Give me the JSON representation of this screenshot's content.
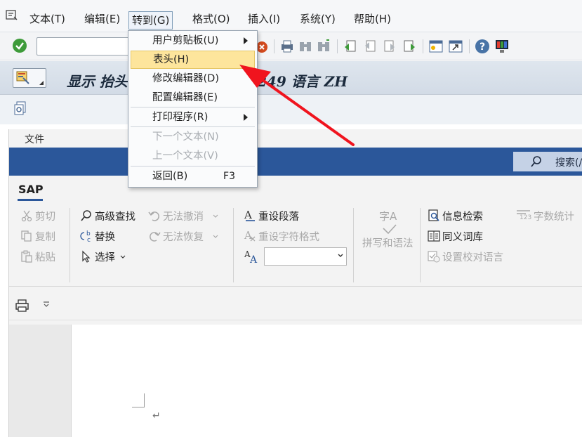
{
  "menubar": {
    "items": [
      {
        "label": "文本(T)"
      },
      {
        "label": "编辑(E)"
      },
      {
        "label": "转到(G)"
      },
      {
        "label": "格式(O)"
      },
      {
        "label": "插入(I)"
      },
      {
        "label": "系统(Y)"
      },
      {
        "label": "帮助(H)"
      }
    ]
  },
  "toolbar": {
    "command_value": ""
  },
  "title": {
    "main": "显示 抬头",
    "suffix": "249 语言 ZH"
  },
  "dropdown": {
    "items": [
      {
        "label": "用户剪贴板(U)",
        "submenu": true
      },
      {
        "label": "表头(H)",
        "highlighted": true
      },
      {
        "label": "修改编辑器(D)"
      },
      {
        "label": "配置编辑器(E)"
      },
      {
        "label": "打印程序(R)",
        "submenu": true
      },
      {
        "label": "下一个文本(N)",
        "disabled": true
      },
      {
        "label": "上一个文本(V)",
        "disabled": true
      },
      {
        "label": "返回(B)",
        "shortcut": "F3"
      }
    ]
  },
  "word": {
    "file_tab": "文件",
    "search_label": "搜索(/",
    "sap_tab": "SAP",
    "ribbon": {
      "cut": "剪切",
      "copy": "复制",
      "paste": "粘贴",
      "advanced_find": "高级查找",
      "replace": "替换",
      "select": "选择",
      "undo": "无法撤消",
      "redo": "无法恢复",
      "reset_paragraph": "重设段落",
      "reset_char_format": "重设字符格式",
      "spelling_grammar": "拼写和语法",
      "spelling_icon_text": "字A",
      "research": "信息检索",
      "thesaurus": "同义词库",
      "set_proofing_language": "设置校对语言",
      "word_count": "字数统计",
      "word_count_icon_text": "123",
      "font_size_value": ""
    },
    "para_mark": "↵"
  },
  "colors": {
    "accent_blue": "#2b579a",
    "highlight": "#fde59c",
    "arrow": "#f0141e"
  }
}
